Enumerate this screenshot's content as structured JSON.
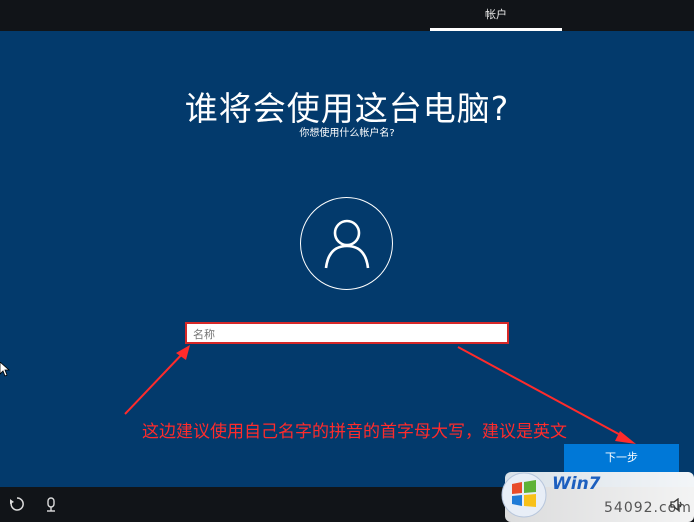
{
  "top_bar": {
    "tab_label": "帐户"
  },
  "main": {
    "title": "谁将会使用这台电脑?",
    "subtitle": "你想使用什么帐户名?",
    "avatar_icon": "person-icon",
    "name_placeholder": "名称",
    "name_value": "",
    "annotation_text": "这边建议使用自己名字的拼音的首字母大写，建议是英文",
    "annotation_color": "#ff2b2b",
    "next_button_label": "下一步"
  },
  "bottom_bar": {
    "icons": [
      "ease-of-access-icon",
      "microphone-icon",
      "volume-icon"
    ]
  },
  "watermark": {
    "brand": "Win7",
    "number": "54092.com"
  },
  "colors": {
    "background": "#033a6c",
    "accent": "#0078d7",
    "bar": "#111418"
  }
}
